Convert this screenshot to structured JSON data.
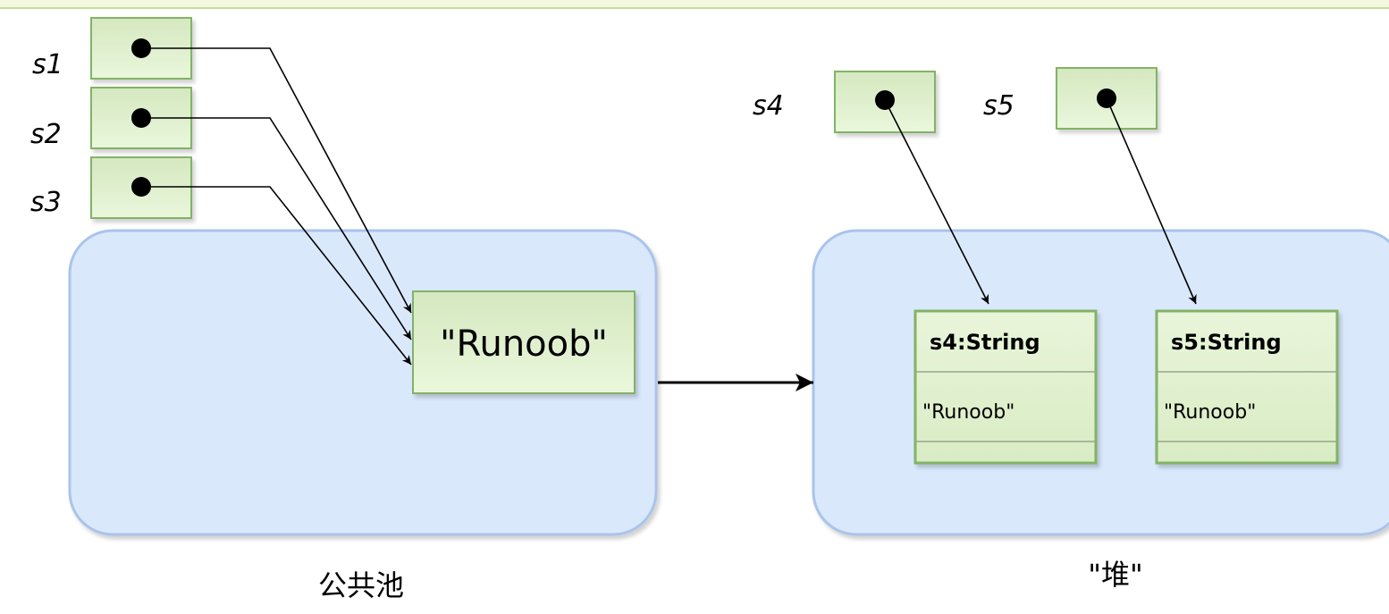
{
  "variables": {
    "s1": "s1",
    "s2": "s2",
    "s3": "s3",
    "s4": "s4",
    "s5": "s5"
  },
  "pool": {
    "literal": "\"Runoob\"",
    "caption": "公共池"
  },
  "heap": {
    "caption": "\"堆\"",
    "objects": [
      {
        "title": "s4:String",
        "value": "\"Runoob\""
      },
      {
        "title": "s5:String",
        "value": "\"Runoob\""
      }
    ]
  },
  "colors": {
    "ref_box_fill": "#dff0d0",
    "ref_box_stroke": "#82b366",
    "region_fill": "#dae8fc",
    "region_stroke": "#a9c4eb",
    "object_fill": "#e6f5d0",
    "object_stroke": "#82b366"
  }
}
